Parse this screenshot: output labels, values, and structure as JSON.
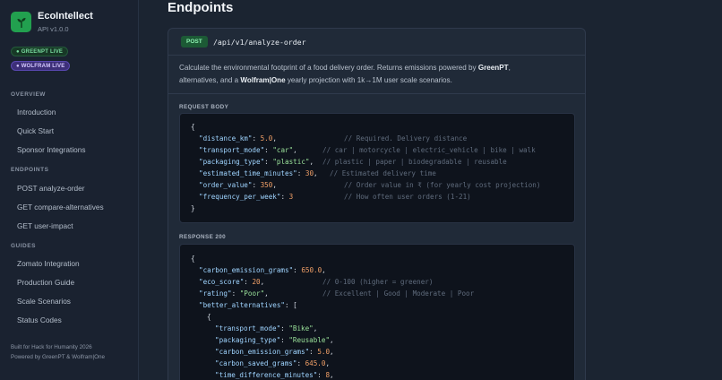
{
  "brand": {
    "title": "EcoIntellect",
    "version": "API v1.0.0"
  },
  "badges": {
    "greenpt": "● GREENPT LIVE",
    "wolfram": "● WOLFRAM LIVE"
  },
  "nav": {
    "overview_heading": "OVERVIEW",
    "overview": [
      "Introduction",
      "Quick Start",
      "Sponsor Integrations"
    ],
    "endpoints_heading": "ENDPOINTS",
    "endpoints": [
      "POST analyze-order",
      "GET compare-alternatives",
      "GET user-impact"
    ],
    "guides_heading": "GUIDES",
    "guides": [
      "Zomato Integration",
      "Production Guide",
      "Scale Scenarios",
      "Status Codes"
    ]
  },
  "footer": {
    "line1": "Built for Hack for Humanity 2026",
    "line2": "Powered by GreenPT & Wolfram|One"
  },
  "main": {
    "title": "Endpoints",
    "method": "POST",
    "path": "/api/v1/analyze-order",
    "desc_part1": "Calculate the environmental footprint of a food delivery order. Returns emissions powered by ",
    "desc_bold1": "GreenPT",
    "desc_part2": ",",
    "desc_part3": "alternatives, and a ",
    "desc_bold2": "Wolfram|One",
    "desc_part4": " yearly projection with 1k→1M user scale scenarios.",
    "request_label": "REQUEST BODY",
    "response_label": "RESPONSE 200"
  },
  "request_code": {
    "open": "{",
    "l1k": "\"distance_km\"",
    "l1v": "5.0",
    "l1c": "// Required. Delivery distance",
    "l2k": "\"transport_mode\"",
    "l2v": "\"car\"",
    "l2c": "// car | motorcycle | electric_vehicle | bike | walk",
    "l3k": "\"packaging_type\"",
    "l3v": "\"plastic\"",
    "l3c": "// plastic | paper | biodegradable | reusable",
    "l4k": "\"estimated_time_minutes\"",
    "l4v": "30",
    "l4c": "// Estimated delivery time",
    "l5k": "\"order_value\"",
    "l5v": "350",
    "l5c": "// Order value in ₹ (for yearly cost projection)",
    "l6k": "\"frequency_per_week\"",
    "l6v": "3",
    "l6c": "// How often user orders (1-21)",
    "close": "}"
  },
  "response_code": {
    "open": "{",
    "l1k": "\"carbon_emission_grams\"",
    "l1v": "650.0",
    "l2k": "\"eco_score\"",
    "l2v": "20",
    "l2c": "// 0-100 (higher = greener)",
    "l3k": "\"rating\"",
    "l3v": "\"Poor\"",
    "l3c": "// Excellent | Good | Moderate | Poor",
    "l4k": "\"better_alternatives\"",
    "l4v": "[",
    "l5": "{",
    "l6k": "\"transport_mode\"",
    "l6v": "\"Bike\"",
    "l7k": "\"packaging_type\"",
    "l7v": "\"Reusable\"",
    "l8k": "\"carbon_emission_grams\"",
    "l8v": "5.0",
    "l9k": "\"carbon_saved_grams\"",
    "l9v": "645.0",
    "l10k": "\"time_difference_minutes\"",
    "l10v": "8"
  }
}
